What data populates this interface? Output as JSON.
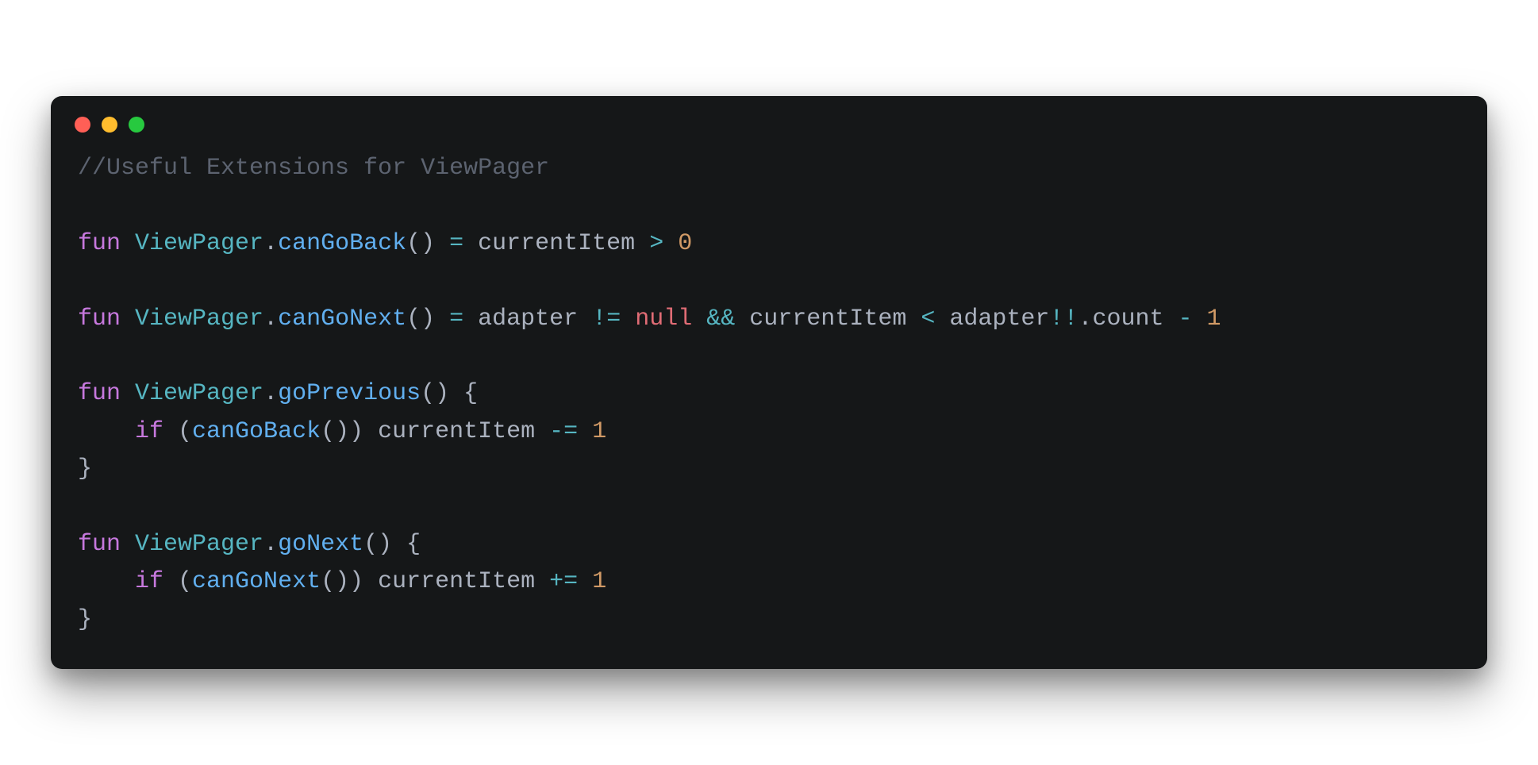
{
  "colors": {
    "background": "#151718",
    "comment": "#5c6370",
    "keyword": "#c678dd",
    "type": "#56b6c2",
    "func": "#61afef",
    "ident": "#abb2bf",
    "punct": "#abb2bf",
    "op": "#56b6c2",
    "null": "#e06c75",
    "number": "#d19a66",
    "trafficRed": "#ff5f56",
    "trafficYellow": "#ffbd2e",
    "trafficGreen": "#27c93f"
  },
  "code": {
    "language": "kotlin",
    "lines": [
      [
        {
          "cls": "tok-comment",
          "t": "//Useful Extensions for ViewPager"
        }
      ],
      [],
      [
        {
          "cls": "tok-keyword",
          "t": "fun"
        },
        {
          "cls": "tok-punct",
          "t": " "
        },
        {
          "cls": "tok-type",
          "t": "ViewPager"
        },
        {
          "cls": "tok-punct",
          "t": "."
        },
        {
          "cls": "tok-func",
          "t": "canGoBack"
        },
        {
          "cls": "tok-punct",
          "t": "() "
        },
        {
          "cls": "tok-op",
          "t": "="
        },
        {
          "cls": "tok-punct",
          "t": " "
        },
        {
          "cls": "tok-ident",
          "t": "currentItem"
        },
        {
          "cls": "tok-punct",
          "t": " "
        },
        {
          "cls": "tok-op",
          "t": ">"
        },
        {
          "cls": "tok-punct",
          "t": " "
        },
        {
          "cls": "tok-number",
          "t": "0"
        }
      ],
      [],
      [
        {
          "cls": "tok-keyword",
          "t": "fun"
        },
        {
          "cls": "tok-punct",
          "t": " "
        },
        {
          "cls": "tok-type",
          "t": "ViewPager"
        },
        {
          "cls": "tok-punct",
          "t": "."
        },
        {
          "cls": "tok-func",
          "t": "canGoNext"
        },
        {
          "cls": "tok-punct",
          "t": "() "
        },
        {
          "cls": "tok-op",
          "t": "="
        },
        {
          "cls": "tok-punct",
          "t": " "
        },
        {
          "cls": "tok-ident",
          "t": "adapter"
        },
        {
          "cls": "tok-punct",
          "t": " "
        },
        {
          "cls": "tok-op",
          "t": "!="
        },
        {
          "cls": "tok-punct",
          "t": " "
        },
        {
          "cls": "tok-null",
          "t": "null"
        },
        {
          "cls": "tok-punct",
          "t": " "
        },
        {
          "cls": "tok-op",
          "t": "&&"
        },
        {
          "cls": "tok-punct",
          "t": " "
        },
        {
          "cls": "tok-ident",
          "t": "currentItem"
        },
        {
          "cls": "tok-punct",
          "t": " "
        },
        {
          "cls": "tok-op",
          "t": "<"
        },
        {
          "cls": "tok-punct",
          "t": " "
        },
        {
          "cls": "tok-ident",
          "t": "adapter"
        },
        {
          "cls": "tok-op",
          "t": "!!"
        },
        {
          "cls": "tok-punct",
          "t": "."
        },
        {
          "cls": "tok-ident",
          "t": "count"
        },
        {
          "cls": "tok-punct",
          "t": " "
        },
        {
          "cls": "tok-op",
          "t": "-"
        },
        {
          "cls": "tok-punct",
          "t": " "
        },
        {
          "cls": "tok-number",
          "t": "1"
        }
      ],
      [],
      [
        {
          "cls": "tok-keyword",
          "t": "fun"
        },
        {
          "cls": "tok-punct",
          "t": " "
        },
        {
          "cls": "tok-type",
          "t": "ViewPager"
        },
        {
          "cls": "tok-punct",
          "t": "."
        },
        {
          "cls": "tok-func",
          "t": "goPrevious"
        },
        {
          "cls": "tok-punct",
          "t": "() {"
        }
      ],
      [
        {
          "cls": "tok-punct",
          "t": "    "
        },
        {
          "cls": "tok-keyword",
          "t": "if"
        },
        {
          "cls": "tok-punct",
          "t": " ("
        },
        {
          "cls": "tok-func",
          "t": "canGoBack"
        },
        {
          "cls": "tok-punct",
          "t": "()) "
        },
        {
          "cls": "tok-ident",
          "t": "currentItem"
        },
        {
          "cls": "tok-punct",
          "t": " "
        },
        {
          "cls": "tok-op",
          "t": "-="
        },
        {
          "cls": "tok-punct",
          "t": " "
        },
        {
          "cls": "tok-number",
          "t": "1"
        }
      ],
      [
        {
          "cls": "tok-punct",
          "t": "}"
        }
      ],
      [],
      [
        {
          "cls": "tok-keyword",
          "t": "fun"
        },
        {
          "cls": "tok-punct",
          "t": " "
        },
        {
          "cls": "tok-type",
          "t": "ViewPager"
        },
        {
          "cls": "tok-punct",
          "t": "."
        },
        {
          "cls": "tok-func",
          "t": "goNext"
        },
        {
          "cls": "tok-punct",
          "t": "() {"
        }
      ],
      [
        {
          "cls": "tok-punct",
          "t": "    "
        },
        {
          "cls": "tok-keyword",
          "t": "if"
        },
        {
          "cls": "tok-punct",
          "t": " ("
        },
        {
          "cls": "tok-func",
          "t": "canGoNext"
        },
        {
          "cls": "tok-punct",
          "t": "()) "
        },
        {
          "cls": "tok-ident",
          "t": "currentItem"
        },
        {
          "cls": "tok-punct",
          "t": " "
        },
        {
          "cls": "tok-op",
          "t": "+="
        },
        {
          "cls": "tok-punct",
          "t": " "
        },
        {
          "cls": "tok-number",
          "t": "1"
        }
      ],
      [
        {
          "cls": "tok-punct",
          "t": "}"
        }
      ]
    ]
  }
}
